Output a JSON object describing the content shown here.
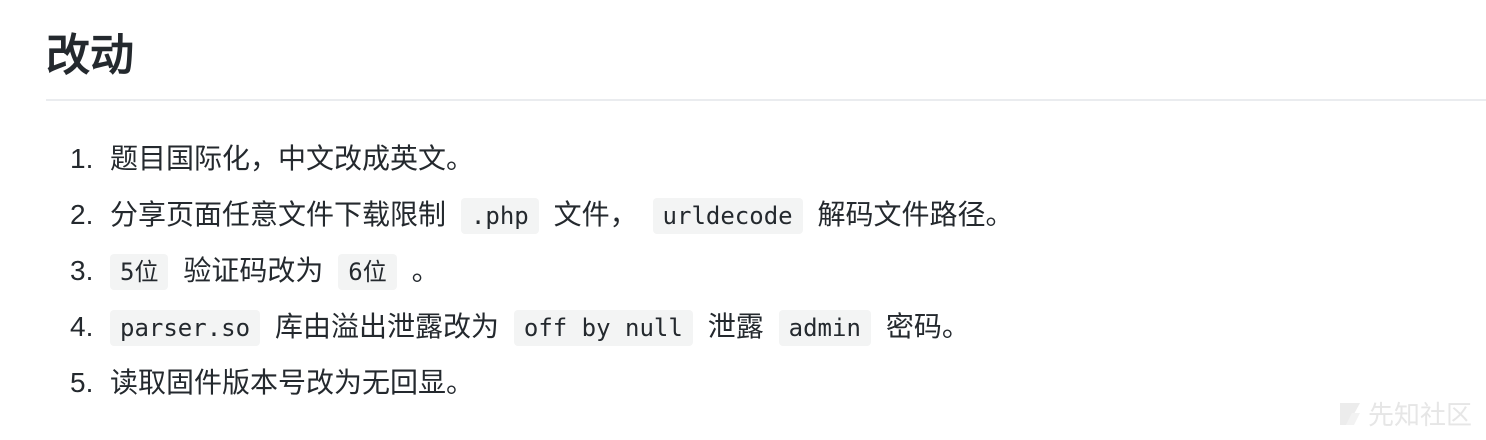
{
  "heading": "改动",
  "items": [
    {
      "number": "1.",
      "parts": [
        "题目国际化，中文改成英文。"
      ]
    },
    {
      "number": "2.",
      "parts": [
        "分享页面任意文件下载限制",
        ".php",
        "文件，",
        "urldecode",
        "解码文件路径。"
      ]
    },
    {
      "number": "3.",
      "parts": [
        "5位",
        "验证码改为",
        "6位",
        "。"
      ]
    },
    {
      "number": "4.",
      "parts": [
        "parser.so",
        "库由溢出泄露改为",
        "off by null",
        "泄露",
        "admin",
        "密码。"
      ]
    },
    {
      "number": "5.",
      "parts": [
        "读取固件版本号改为无回显。"
      ]
    }
  ],
  "watermark": "先知社区",
  "icons": {
    "watermark_logo": "xianzhi-logo-icon"
  }
}
